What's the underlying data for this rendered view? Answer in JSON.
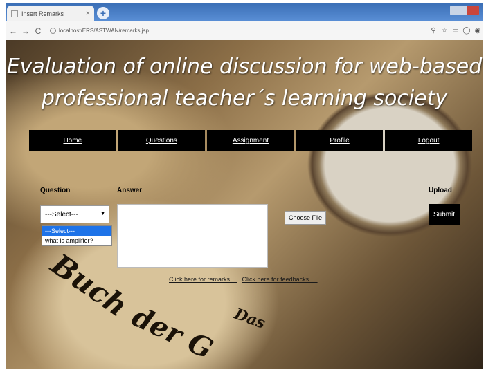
{
  "browser": {
    "tab_title": "Insert Remarks",
    "tab_close": "×",
    "new_tab": "+",
    "nav_back": "←",
    "nav_forward": "→",
    "nav_reload": "C",
    "url": "localhost/ERS/ASTWAN/remarks.jsp",
    "toolbar_icons": [
      "search-icon",
      "star-icon",
      "cast-icon",
      "extension-icon",
      "account-icon"
    ]
  },
  "page": {
    "headline": "Evaluation of online discussion for web-based professional teacher´s learning society",
    "nav": [
      "Home",
      "Questions",
      "Assignment",
      "Profile",
      "Logout"
    ],
    "labels": {
      "question": "Question",
      "answer": "Answer",
      "upload": "Upload"
    },
    "select": {
      "value": "---Select---",
      "options": [
        "---Select---",
        "what is amplifier?"
      ]
    },
    "choose_file": "Choose File",
    "submit": "Submit",
    "links": {
      "remarks": "Click here for remarks....",
      "feedbacks": "Click here for feedbacks....."
    },
    "background_text": {
      "line1": "Buch",
      "line2": "der G",
      "line3": "Das"
    }
  },
  "colors": {
    "tab_bar": "#3b6fb6",
    "nav_bg": "#000000",
    "selected_option": "#1e73e8"
  }
}
